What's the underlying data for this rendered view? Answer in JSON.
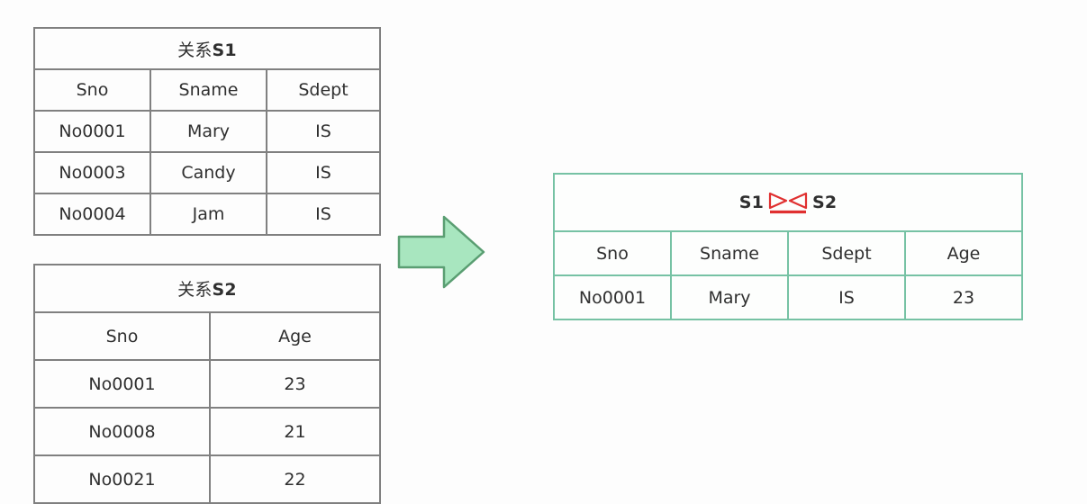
{
  "page": {
    "background_color": "#fdfdfd",
    "description": "Relational algebra natural join illustration"
  },
  "colors": {
    "table_border_gray": "#808080",
    "table_border_green": "#76c2a4",
    "arrow_fill": "#a8e6bf",
    "arrow_stroke": "#5a9e72",
    "join_symbol_red": "#e03030",
    "text": "#2f2f2f"
  },
  "tables": {
    "s1": {
      "title_prefix": "关系",
      "title_id": "S1",
      "title": "关系S1",
      "columns": [
        "Sno",
        "Sname",
        "Sdept"
      ],
      "rows": [
        [
          "No0001",
          "Mary",
          "IS"
        ],
        [
          "No0003",
          "Candy",
          "IS"
        ],
        [
          "No0004",
          "Jam",
          "IS"
        ]
      ]
    },
    "s2": {
      "title_prefix": "关系",
      "title_id": "S2",
      "title": "关系S2",
      "columns": [
        "Sno",
        "Age"
      ],
      "rows": [
        [
          "No0001",
          "23"
        ],
        [
          "No0008",
          "21"
        ],
        [
          "No0021",
          "22"
        ]
      ]
    },
    "result": {
      "title_left": "S1",
      "title_right": "S2",
      "title_operator": "natural-join-bowtie",
      "title": "S1 ⋈ S2",
      "columns": [
        "Sno",
        "Sname",
        "Sdept",
        "Age"
      ],
      "rows": [
        [
          "No0001",
          "Mary",
          "IS",
          "23"
        ]
      ]
    }
  },
  "arrow": {
    "icon": "right-arrow-icon",
    "direction": "right"
  }
}
